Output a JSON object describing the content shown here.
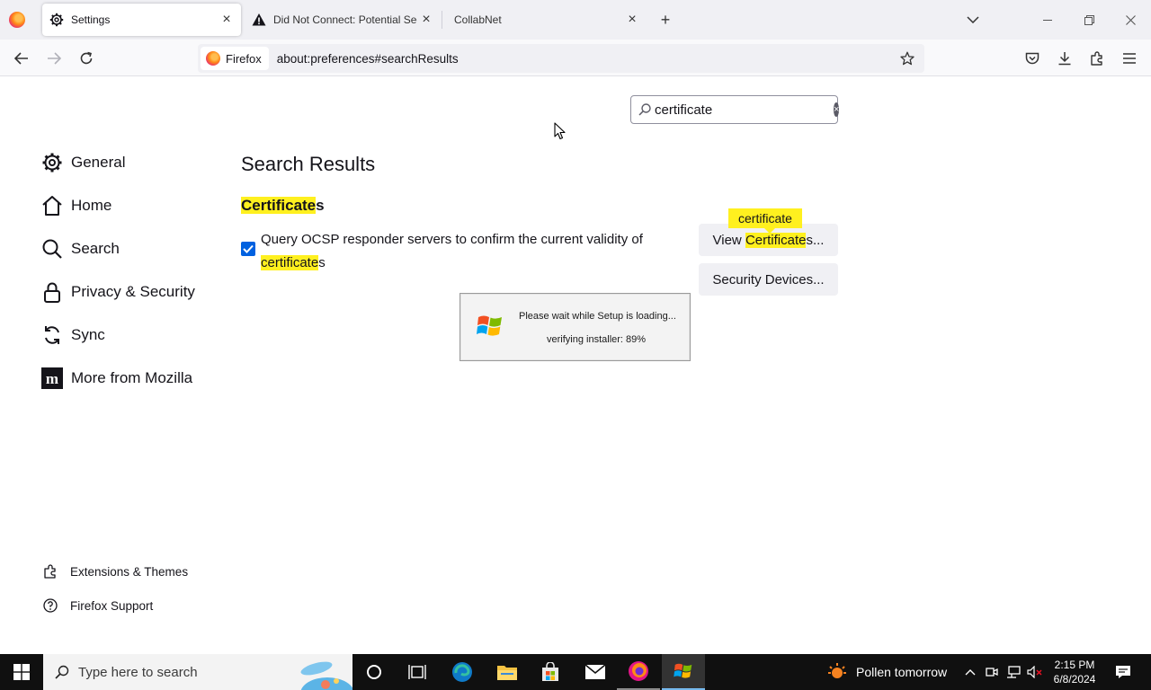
{
  "browser": {
    "tabs": [
      {
        "title": "Settings",
        "icon": "gear-icon",
        "active": true
      },
      {
        "title": "Did Not Connect: Potential Sec",
        "icon": "warning-icon",
        "active": false
      },
      {
        "title": "CollabNet",
        "icon": "",
        "active": false
      }
    ],
    "identity_label": "Firefox",
    "url": "about:preferences#searchResults"
  },
  "settings": {
    "search_value": "certificate",
    "categories": [
      {
        "label": "General",
        "icon": "gear-icon"
      },
      {
        "label": "Home",
        "icon": "home-icon"
      },
      {
        "label": "Search",
        "icon": "search-icon"
      },
      {
        "label": "Privacy & Security",
        "icon": "lock-icon"
      },
      {
        "label": "Sync",
        "icon": "sync-icon"
      },
      {
        "label": "More from Mozilla",
        "icon": "mozilla-icon"
      }
    ],
    "footer_links": [
      {
        "label": "Extensions & Themes",
        "icon": "puzzle-icon"
      },
      {
        "label": "Firefox Support",
        "icon": "help-icon"
      }
    ],
    "results_heading": "Search Results",
    "group": {
      "heading_highlight": "Certificate",
      "heading_rest": "s",
      "ocsp_text": "Query OCSP responder servers to confirm the current validity of",
      "ocsp_highlight": "certificate",
      "ocsp_rest": "s",
      "ocsp_checked": true,
      "tooltip": "certificate",
      "view_btn": {
        "before": "View ",
        "highlight": "Certificate",
        "after": "s..."
      },
      "security_btn": "Security Devices..."
    },
    "highlight_color": "#fff01f",
    "accent_color": "#0061e0"
  },
  "setup_dialog": {
    "line1": "Please wait while Setup is loading...",
    "line2": "verifying installer: 89%"
  },
  "taskbar": {
    "search_placeholder": "Type here to search",
    "weather": "Pollen tomorrow",
    "time": "2:15 PM",
    "date": "6/8/2024",
    "apps": [
      "cortana-icon",
      "task-view-icon",
      "edge-icon",
      "file-explorer-icon",
      "store-icon",
      "mail-icon",
      "firefox-icon",
      "setup-icon"
    ]
  }
}
